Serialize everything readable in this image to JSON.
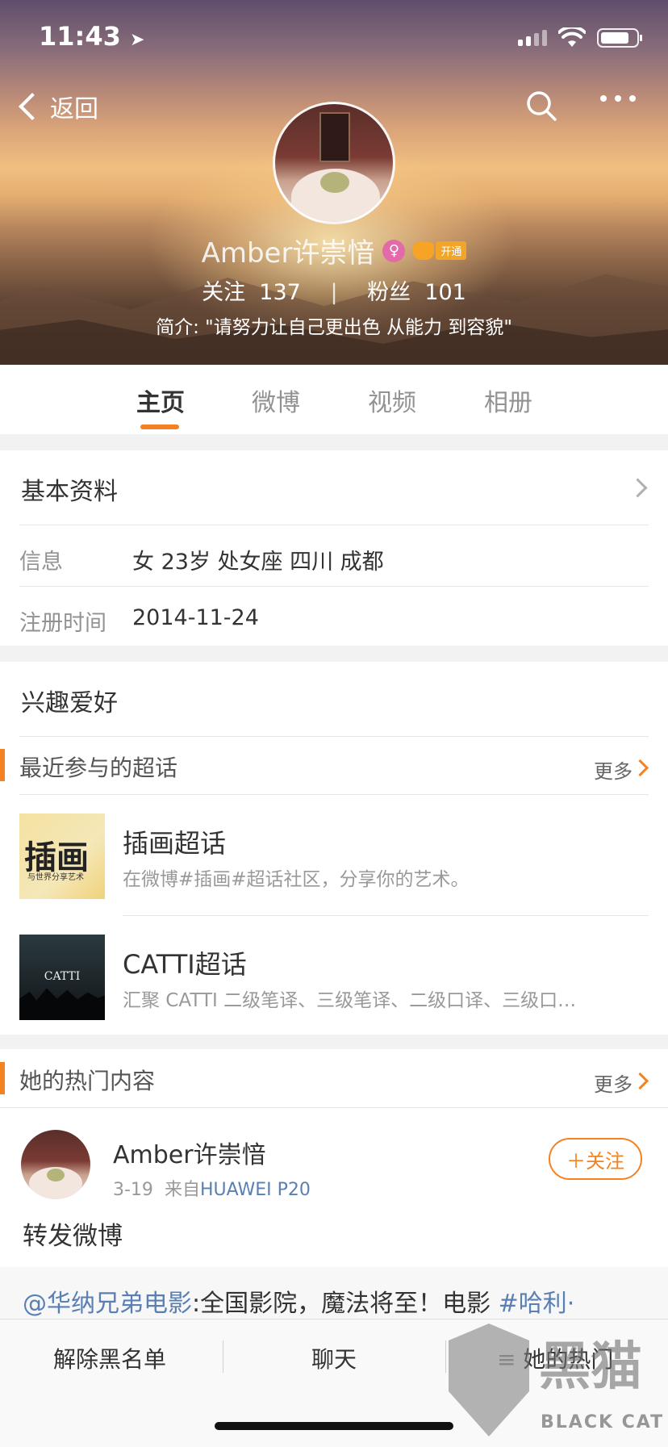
{
  "status": {
    "time": "11:43"
  },
  "nav": {
    "back_label": "返回"
  },
  "profile": {
    "name": "Amber许崇愔",
    "vip_tag": "开通",
    "following_label": "关注",
    "following_count": "137",
    "separator": "|",
    "fans_label": "粉丝",
    "fans_count": "101",
    "bio": "简介: \"请努力让自己更出色 从能力 到容貌\""
  },
  "tabs": [
    {
      "label": "主页",
      "active": true
    },
    {
      "label": "微博",
      "active": false
    },
    {
      "label": "视频",
      "active": false
    },
    {
      "label": "相册",
      "active": false
    }
  ],
  "basic_info": {
    "title": "基本资料",
    "rows": [
      {
        "label": "信息",
        "value": "女  23岁  处女座  四川 成都"
      },
      {
        "label": "注册时间",
        "value": "2014-11-24"
      }
    ]
  },
  "interests": {
    "title": "兴趣爱好"
  },
  "super_topics": {
    "title": "最近参与的超话",
    "more": "更多",
    "items": [
      {
        "title": "插画超话",
        "desc": "在微博#插画#超话社区，分享你的艺术。",
        "thumb_text": "插画",
        "thumb_sub": "与世界分享艺术"
      },
      {
        "title": "CATTI超话",
        "desc": "汇聚 CATTI 二级笔译、三级笔译、二级口译、三级口…",
        "thumb_text": "CATTI"
      }
    ]
  },
  "hot_content": {
    "title": "她的热门内容",
    "more": "更多",
    "post": {
      "author": "Amber许崇愔",
      "date": "3-19",
      "from_label": "来自",
      "source": "HUAWEI P20",
      "follow_label": "＋关注",
      "text": "转发微博",
      "repost_mention": "@华纳兄弟电影",
      "repost_body": ":全国影院，魔法将至！电影 ",
      "repost_tag": "#哈利·"
    }
  },
  "bottom_bar": {
    "unblock": "解除黑名单",
    "chat": "聊天",
    "hot": "她的热门"
  },
  "watermark": {
    "big": "黑猫",
    "small": "BLACK CAT"
  }
}
